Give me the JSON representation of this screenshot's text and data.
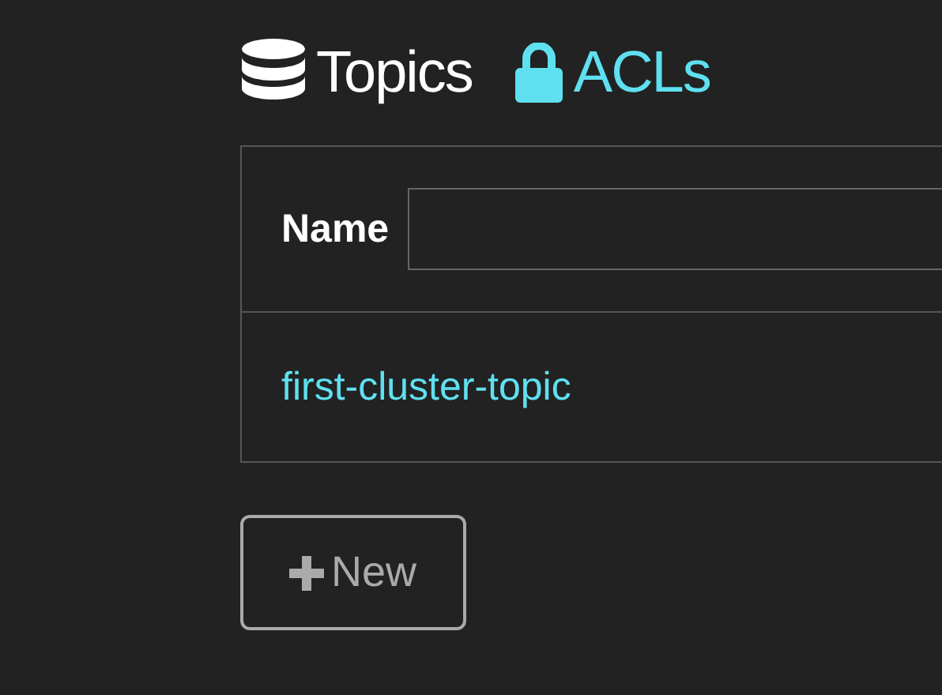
{
  "tabs": [
    {
      "label": "Topics",
      "selected": true
    },
    {
      "label": "ACLs",
      "selected": false
    }
  ],
  "filter": {
    "label": "Name"
  },
  "topics": [
    "first-cluster-topic"
  ],
  "new_button": {
    "label": "New"
  }
}
